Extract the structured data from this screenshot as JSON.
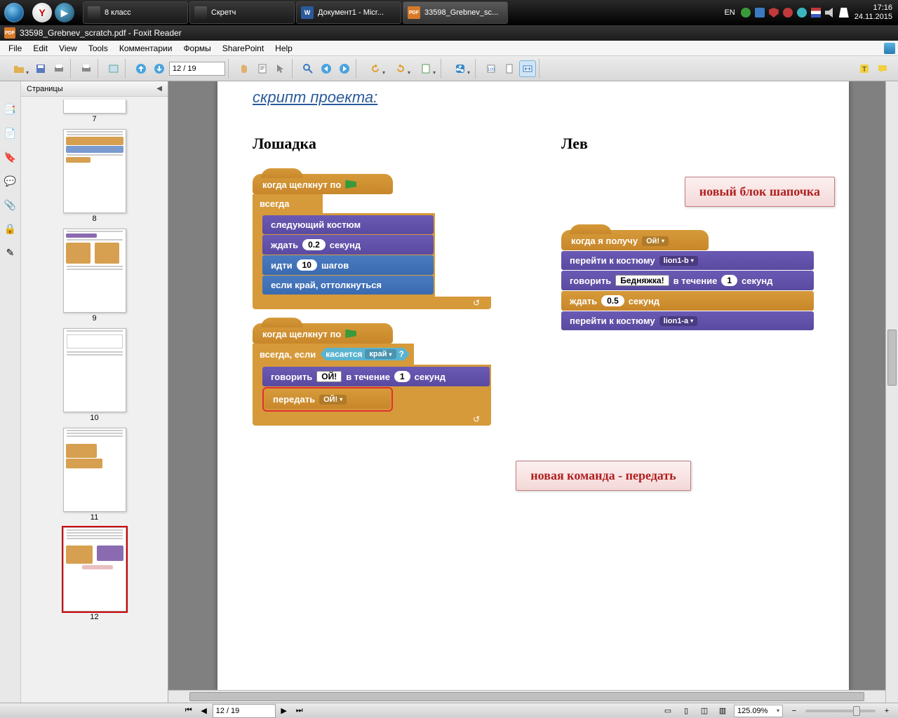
{
  "taskbar": {
    "tasks": [
      {
        "label": "8 класс",
        "type": "folder"
      },
      {
        "label": "Скретч",
        "type": "folder"
      },
      {
        "label": "Документ1 - Micr...",
        "type": "word"
      },
      {
        "label": "33598_Grebnev_sc...",
        "type": "pdf",
        "active": true
      }
    ],
    "lang": "EN",
    "time": "17:16",
    "date": "24.11.2015"
  },
  "window": {
    "title": "33598_Grebnev_scratch.pdf - Foxit Reader"
  },
  "menu": [
    "File",
    "Edit",
    "View",
    "Tools",
    "Комментарии",
    "Формы",
    "SharePoint",
    "Help"
  ],
  "toolbar": {
    "page": "12 / 19"
  },
  "sidebar": {
    "title": "Страницы",
    "pages": [
      7,
      8,
      9,
      10,
      11,
      12
    ],
    "selected": 12
  },
  "doc": {
    "heading": "скрипт проекта:",
    "left_title": "Лошадка",
    "right_title": "Лев",
    "callout_top": "новый блок шапочка",
    "callout_bottom": "новая команда - передать",
    "s1": {
      "hat": "когда щелкнут по",
      "forever": "всегда",
      "next_costume": "следующий костюм",
      "wait": "ждать",
      "wait_val": "0.2",
      "seconds": "секунд",
      "move": "идти",
      "move_val": "10",
      "steps": "шагов",
      "bounce": "если край, оттолкнуться"
    },
    "s2": {
      "hat": "когда щелкнут по",
      "forever_if": "всегда, если",
      "touching": "касается",
      "touching_arg": "край",
      "q": "?",
      "say": "говорить",
      "say_txt": "ОЙ!",
      "for": "в течение",
      "say_val": "1",
      "seconds": "секунд",
      "broadcast": "передать",
      "broadcast_arg": "ОЙ!"
    },
    "s3": {
      "hat": "когда я получу",
      "hat_arg": "Ой!",
      "switch1": "перейти к костюму",
      "c1": "lion1-b",
      "say": "говорить",
      "say_txt": "Бедняжка!",
      "for": "в течение",
      "say_val": "1",
      "seconds": "секунд",
      "wait": "ждать",
      "wait_val": "0.5",
      "wseconds": "секунд",
      "switch2": "перейти к костюму",
      "c2": "lion1-a"
    }
  },
  "statusbar": {
    "page": "12 / 19",
    "zoom": "125.09%"
  }
}
